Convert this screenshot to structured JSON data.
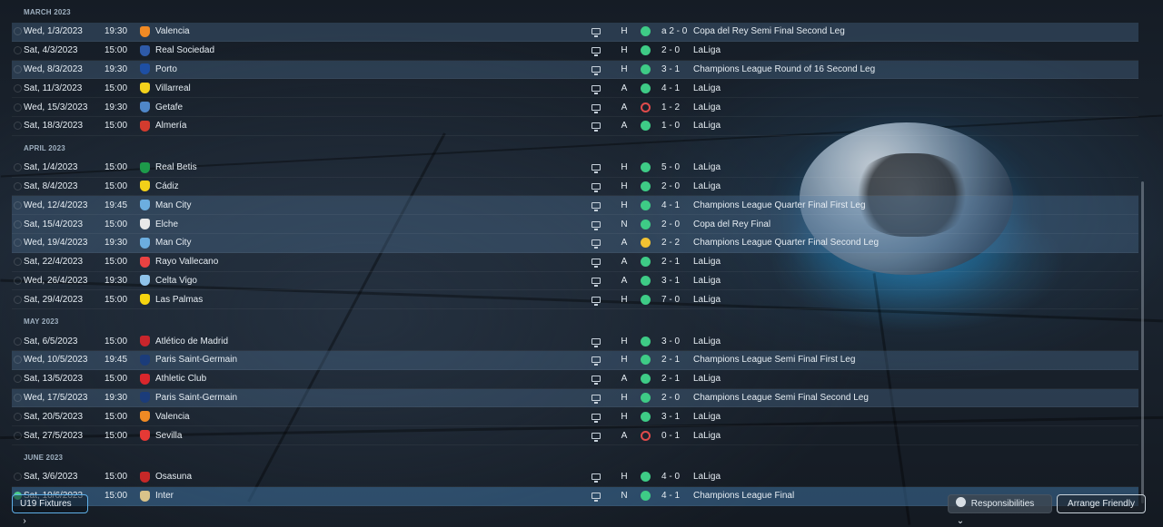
{
  "months": [
    {
      "label": "MARCH 2023",
      "fixtures": [
        {
          "date": "Wed, 1/3/2023",
          "time": "19:30",
          "opponent": "Valencia",
          "crest_color": "#f08a24",
          "venue": "H",
          "result": "win",
          "score": "a 2 - 0",
          "competition": "Copa del Rey Semi Final Second Leg",
          "highlight": true
        },
        {
          "date": "Sat, 4/3/2023",
          "time": "15:00",
          "opponent": "Real Sociedad",
          "crest_color": "#2e5aa8",
          "venue": "H",
          "result": "win",
          "score": "2 - 0",
          "competition": "LaLiga",
          "highlight": false
        },
        {
          "date": "Wed, 8/3/2023",
          "time": "19:30",
          "opponent": "Porto",
          "crest_color": "#1e4fa3",
          "venue": "H",
          "result": "win",
          "score": "3 - 1",
          "competition": "Champions League Round of 16  Second Leg",
          "highlight": true
        },
        {
          "date": "Sat, 11/3/2023",
          "time": "15:00",
          "opponent": "Villarreal",
          "crest_color": "#f3d21c",
          "venue": "A",
          "result": "win",
          "score": "4 - 1",
          "competition": "LaLiga",
          "highlight": false
        },
        {
          "date": "Wed, 15/3/2023",
          "time": "19:30",
          "opponent": "Getafe",
          "crest_color": "#4f87c9",
          "venue": "A",
          "result": "loss",
          "score": "1 - 2",
          "competition": "LaLiga",
          "highlight": false
        },
        {
          "date": "Sat, 18/3/2023",
          "time": "15:00",
          "opponent": "Almería",
          "crest_color": "#d33b2e",
          "venue": "A",
          "result": "win",
          "score": "1 - 0",
          "competition": "LaLiga",
          "highlight": false
        }
      ]
    },
    {
      "label": "APRIL 2023",
      "fixtures": [
        {
          "date": "Sat, 1/4/2023",
          "time": "15:00",
          "opponent": "Real Betis",
          "crest_color": "#1d9a4a",
          "venue": "H",
          "result": "win",
          "score": "5 - 0",
          "competition": "LaLiga",
          "highlight": false
        },
        {
          "date": "Sat, 8/4/2023",
          "time": "15:00",
          "opponent": "Cádiz",
          "crest_color": "#f2d019",
          "venue": "H",
          "result": "win",
          "score": "2 - 0",
          "competition": "LaLiga",
          "highlight": false
        },
        {
          "date": "Wed, 12/4/2023",
          "time": "19:45",
          "opponent": "Man City",
          "crest_color": "#6caee0",
          "venue": "H",
          "result": "win",
          "score": "4 - 1",
          "competition": "Champions League Quarter Final First Leg",
          "highlight": true
        },
        {
          "date": "Sat, 15/4/2023",
          "time": "15:00",
          "opponent": "Elche",
          "crest_color": "#e8e8e8",
          "venue": "N",
          "result": "win",
          "score": "2 - 0",
          "competition": "Copa del Rey Final",
          "highlight": true
        },
        {
          "date": "Wed, 19/4/2023",
          "time": "19:30",
          "opponent": "Man City",
          "crest_color": "#6caee0",
          "venue": "A",
          "result": "draw",
          "score": "2 - 2",
          "competition": "Champions League Quarter Final Second Leg",
          "highlight": true
        },
        {
          "date": "Sat, 22/4/2023",
          "time": "15:00",
          "opponent": "Rayo Vallecano",
          "crest_color": "#e94242",
          "venue": "A",
          "result": "win",
          "score": "2 - 1",
          "competition": "LaLiga",
          "highlight": false
        },
        {
          "date": "Wed, 26/4/2023",
          "time": "19:30",
          "opponent": "Celta Vigo",
          "crest_color": "#8fc3ea",
          "venue": "A",
          "result": "win",
          "score": "3 - 1",
          "competition": "LaLiga",
          "highlight": false
        },
        {
          "date": "Sat, 29/4/2023",
          "time": "15:00",
          "opponent": "Las Palmas",
          "crest_color": "#f5d40f",
          "venue": "H",
          "result": "win",
          "score": "7 - 0",
          "competition": "LaLiga",
          "highlight": false
        }
      ]
    },
    {
      "label": "MAY 2023",
      "fixtures": [
        {
          "date": "Sat, 6/5/2023",
          "time": "15:00",
          "opponent": "Atlético de Madrid",
          "crest_color": "#c8252c",
          "venue": "H",
          "result": "win",
          "score": "3 - 0",
          "competition": "LaLiga",
          "highlight": false
        },
        {
          "date": "Wed, 10/5/2023",
          "time": "19:45",
          "opponent": "Paris Saint-Germain",
          "crest_color": "#1b3c7a",
          "venue": "H",
          "result": "win",
          "score": "2 - 1",
          "competition": "Champions League Semi Final First Leg",
          "highlight": true
        },
        {
          "date": "Sat, 13/5/2023",
          "time": "15:00",
          "opponent": "Athletic Club",
          "crest_color": "#d8262c",
          "venue": "A",
          "result": "win",
          "score": "2 - 1",
          "competition": "LaLiga",
          "highlight": false
        },
        {
          "date": "Wed, 17/5/2023",
          "time": "19:30",
          "opponent": "Paris Saint-Germain",
          "crest_color": "#1b3c7a",
          "venue": "H",
          "result": "win",
          "score": "2 - 0",
          "competition": "Champions League Semi Final Second Leg",
          "highlight": true
        },
        {
          "date": "Sat, 20/5/2023",
          "time": "15:00",
          "opponent": "Valencia",
          "crest_color": "#f08a24",
          "venue": "H",
          "result": "win",
          "score": "3 - 1",
          "competition": "LaLiga",
          "highlight": false
        },
        {
          "date": "Sat, 27/5/2023",
          "time": "15:00",
          "opponent": "Sevilla",
          "crest_color": "#e53935",
          "venue": "A",
          "result": "loss",
          "score": "0 - 1",
          "competition": "LaLiga",
          "highlight": false
        }
      ]
    },
    {
      "label": "JUNE 2023",
      "fixtures": [
        {
          "date": "Sat, 3/6/2023",
          "time": "15:00",
          "opponent": "Osasuna",
          "crest_color": "#c62828",
          "venue": "H",
          "result": "win",
          "score": "4 - 0",
          "competition": "LaLiga",
          "highlight": false
        },
        {
          "date": "Sat, 10/6/2023",
          "time": "15:00",
          "opponent": "Inter",
          "crest_color": "#d9c38a",
          "venue": "N",
          "result": "win",
          "score": "4 - 1",
          "competition": "Champions League Final",
          "highlight": "selected"
        }
      ]
    }
  ],
  "footer": {
    "u19_label": "U19 Fixtures",
    "u19_icon": "chevron-right-icon",
    "responsibilities_label": "Responsibilities",
    "responsibilities_icon": "person-circle-icon",
    "arrange_friendly_label": "Arrange Friendly"
  },
  "colors": {
    "win": "#3ecb86",
    "loss": "#e04b4b",
    "draw": "#f1c232",
    "accent": "#5fb0e8"
  }
}
